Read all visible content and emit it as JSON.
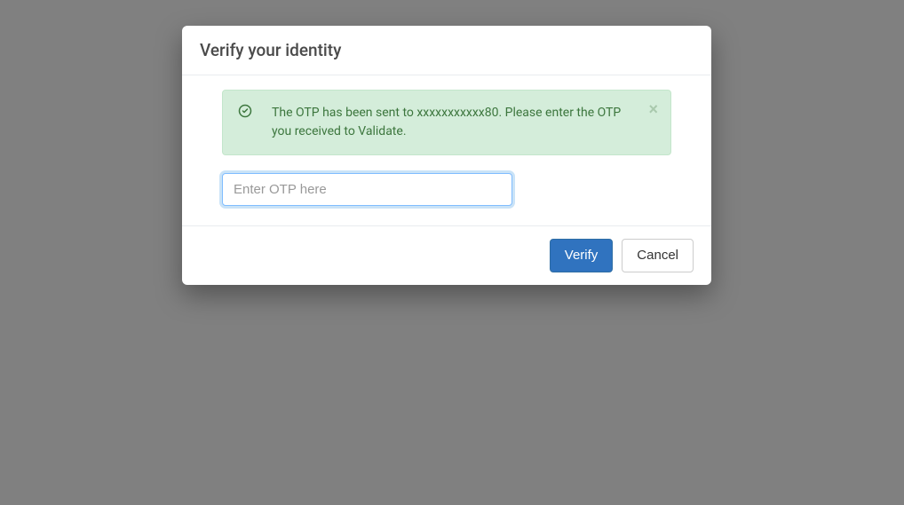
{
  "modal": {
    "title": "Verify your identity",
    "alert": {
      "message": "The OTP has been sent to xxxxxxxxxxx80. Please enter the OTP you received to Validate."
    },
    "otp_input": {
      "placeholder": "Enter OTP here",
      "value": ""
    },
    "buttons": {
      "verify": "Verify",
      "cancel": "Cancel"
    }
  }
}
